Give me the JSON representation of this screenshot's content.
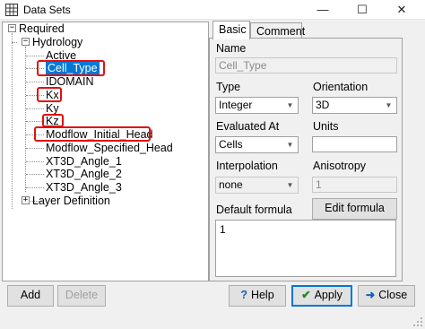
{
  "window": {
    "title": "Data Sets",
    "minimize_glyph": "—",
    "maximize_glyph": "☐",
    "close_glyph": "✕"
  },
  "tree": {
    "root": {
      "label": "Required",
      "expander": "−"
    },
    "group": {
      "label": "Hydrology",
      "expander": "−"
    },
    "items": [
      "Active",
      "Cell_Type",
      "IDOMAIN",
      "Kx",
      "Ky",
      "Kz",
      "Modflow_Initial_Head",
      "Modflow_Specified_Head",
      "XT3D_Angle_1",
      "XT3D_Angle_2",
      "XT3D_Angle_3"
    ],
    "selected_item": "Cell_Type",
    "highlighted_items": [
      "Cell_Type",
      "Kx",
      "Kz",
      "Modflow_Initial_Head"
    ],
    "layer_definition": {
      "label": "Layer Definition",
      "expander": "+"
    }
  },
  "tabs": {
    "basic": "Basic",
    "comment": "Comment",
    "active": "Basic"
  },
  "form": {
    "name_label": "Name",
    "name_value": "Cell_Type",
    "type_label": "Type",
    "type_value": "Integer",
    "orientation_label": "Orientation",
    "orientation_value": "3D",
    "evaluated_at_label": "Evaluated At",
    "evaluated_at_value": "Cells",
    "units_label": "Units",
    "units_value": "",
    "interpolation_label": "Interpolation",
    "interpolation_value": "none",
    "anisotropy_label": "Anisotropy",
    "anisotropy_value": "1",
    "default_formula_label": "Default formula",
    "edit_formula_button": "Edit formula",
    "default_formula_value": "1"
  },
  "buttons": {
    "add": "Add",
    "delete": "Delete",
    "help": "Help",
    "apply": "Apply",
    "close": "Close",
    "help_glyph": "?",
    "apply_glyph": "✔",
    "close_glyph": "➜"
  },
  "colors": {
    "selection": "#0078d7",
    "highlight_box": "#e01010",
    "panel_bg": "#f0f0f0"
  }
}
